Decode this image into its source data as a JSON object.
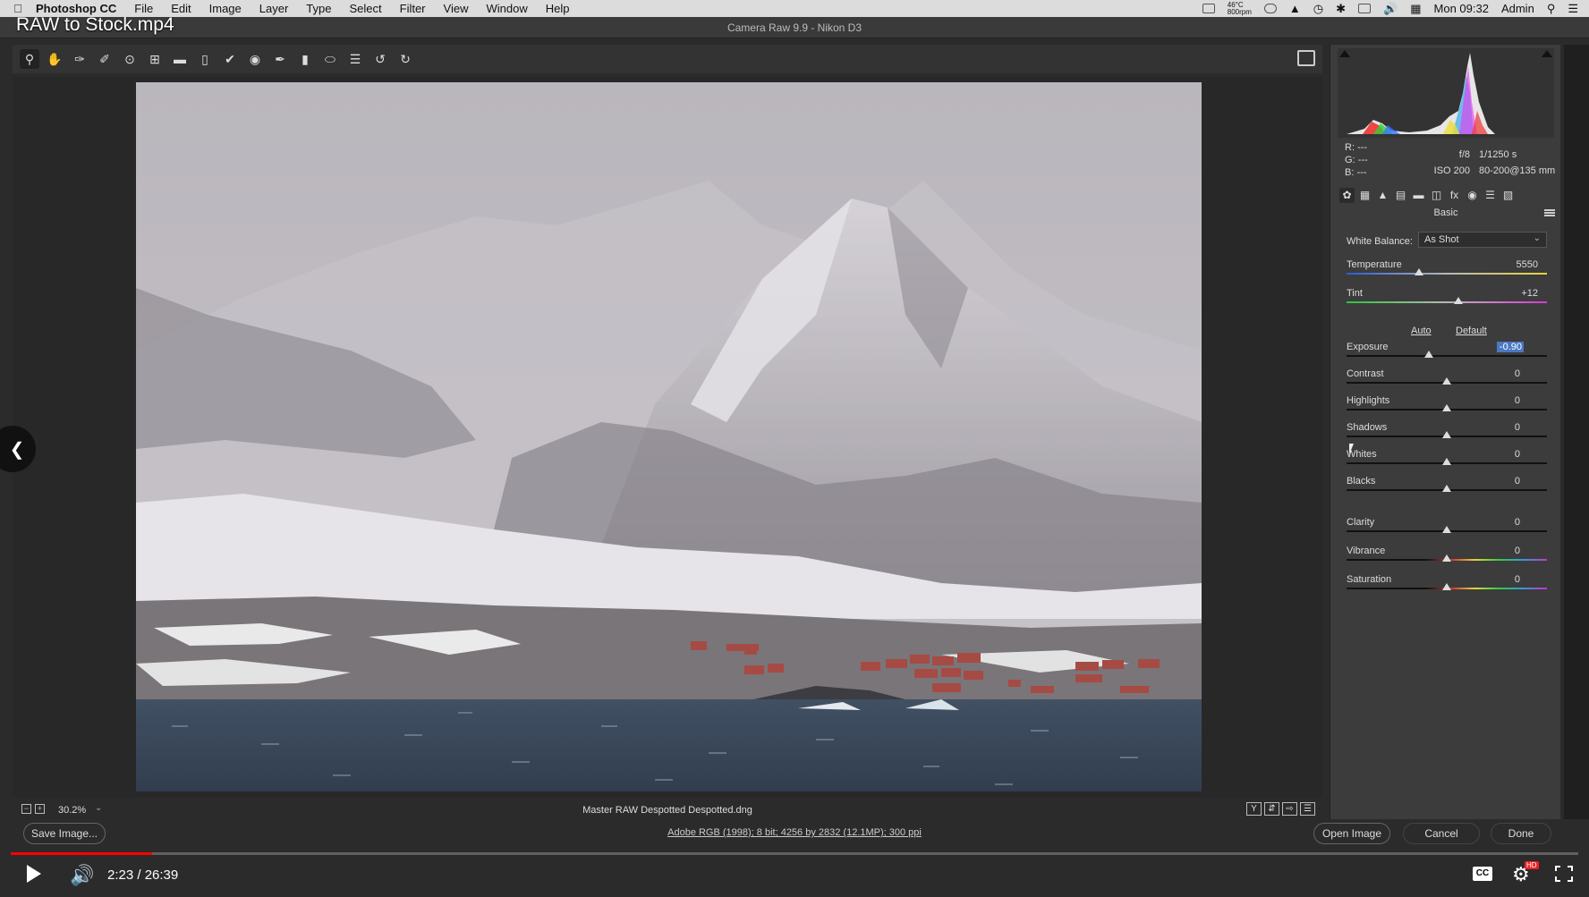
{
  "video": {
    "title": "RAW to Stock.mp4",
    "time": "2:23 / 26:39",
    "progress_fraction": 0.09
  },
  "menubar": {
    "app_name": "Photoshop CC",
    "items": [
      "File",
      "Edit",
      "Image",
      "Layer",
      "Type",
      "Select",
      "Filter",
      "View",
      "Window",
      "Help"
    ],
    "status_temp": "46°C",
    "status_fan": "800rpm",
    "clock": "Mon 09:32",
    "user": "Admin"
  },
  "window": {
    "title": "Camera Raw 9.9  -  Nikon D3"
  },
  "status": {
    "zoom": "30.2%",
    "filename": "Master RAW Despotted Despotted.dng"
  },
  "info": {
    "r_label": "R:",
    "r_val": "---",
    "g_label": "G:",
    "g_val": "---",
    "b_label": "B:",
    "b_val": "---",
    "aperture": "f/8",
    "shutter": "1/1250 s",
    "iso": "ISO 200",
    "lens": "80-200@135 mm"
  },
  "panel": {
    "title": "Basic",
    "wb_label": "White Balance:",
    "wb_value": "As Shot",
    "auto": "Auto",
    "default": "Default",
    "controls": [
      {
        "label": "Temperature",
        "value": "5550",
        "position": 0.36
      },
      {
        "label": "Tint",
        "value": "+12",
        "position": 0.56
      },
      {
        "label": "Exposure",
        "value": "-0.90",
        "position": 0.41
      },
      {
        "label": "Contrast",
        "value": "0",
        "position": 0.5
      },
      {
        "label": "Highlights",
        "value": "0",
        "position": 0.5
      },
      {
        "label": "Shadows",
        "value": "0",
        "position": 0.5
      },
      {
        "label": "Whites",
        "value": "0",
        "position": 0.5
      },
      {
        "label": "Blacks",
        "value": "0",
        "position": 0.5
      },
      {
        "label": "Clarity",
        "value": "0",
        "position": 0.5
      },
      {
        "label": "Vibrance",
        "value": "0",
        "position": 0.5
      },
      {
        "label": "Saturation",
        "value": "0",
        "position": 0.5
      }
    ]
  },
  "bottom": {
    "save_label": "Save Image...",
    "workflow": "Adobe RGB (1998); 8 bit; 4256 by 2832 (12.1MP); 300 ppi",
    "open_label": "Open Image",
    "cancel_label": "Cancel",
    "done_label": "Done"
  },
  "icons": {
    "toolbar": [
      "zoom-icon",
      "hand-icon",
      "white-balance-icon",
      "color-sampler-icon",
      "targeted-adjustment-icon",
      "crop-icon",
      "straighten-icon",
      "transform-icon",
      "spot-removal-icon",
      "red-eye-icon",
      "adjustment-brush-icon",
      "graduated-filter-icon",
      "radial-filter-icon",
      "preferences-icon",
      "rotate-left-icon",
      "rotate-right-icon"
    ],
    "tabs": [
      "basic-tab-icon",
      "tone-curve-tab-icon",
      "detail-tab-icon",
      "hsl-tab-icon",
      "split-toning-tab-icon",
      "lens-tab-icon",
      "effects-tab-icon",
      "camera-calibration-tab-icon",
      "presets-tab-icon",
      "snapshots-tab-icon"
    ]
  },
  "colors": {
    "accent": "#4a78c2",
    "progress": "#ff0000"
  }
}
